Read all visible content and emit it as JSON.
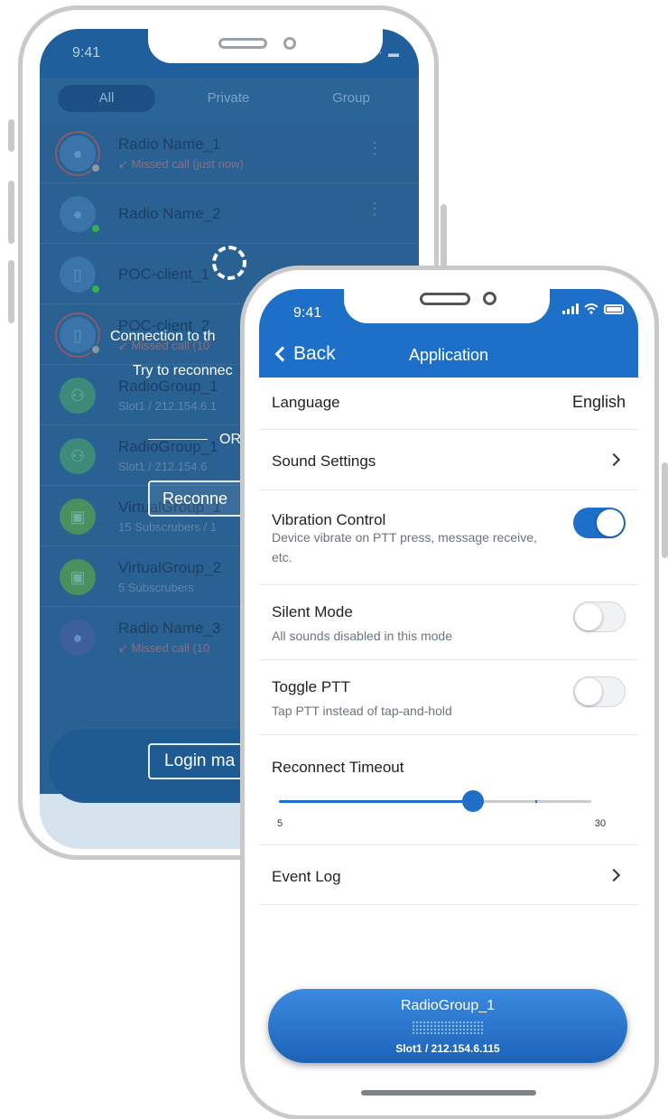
{
  "back_phone": {
    "time": "9:41",
    "tabs": [
      {
        "label": "All",
        "active": true
      },
      {
        "label": "Private",
        "active": false
      },
      {
        "label": "Group",
        "active": false
      }
    ],
    "contacts": [
      {
        "name": "Radio Name_1",
        "sub": "Missed call (just now)",
        "missed": true,
        "status": "grey",
        "icon": "person-icon"
      },
      {
        "name": "Radio Name_2",
        "sub": "",
        "missed": false,
        "status": "green",
        "icon": "person-icon"
      },
      {
        "name": "POC-client_1",
        "sub": "",
        "missed": false,
        "status": "green",
        "icon": "phone-icon"
      },
      {
        "name": "POC-client_2",
        "sub": "Missed call (10",
        "missed": true,
        "status": "grey",
        "icon": "phone-icon"
      },
      {
        "name": "RadioGroup_1",
        "sub": "Slot1 / 212.154.6.1",
        "missed": false,
        "status": "",
        "icon": "group-icon"
      },
      {
        "name": "RadioGroup_1",
        "sub": "Slot1 / 212.154.6",
        "missed": false,
        "status": "",
        "icon": "group-icon"
      },
      {
        "name": "VirtualGroup_1",
        "sub": "15 Subscrubers / 1",
        "missed": false,
        "status": "",
        "icon": "virtual-group-icon"
      },
      {
        "name": "VirtualGroup_2",
        "sub": "5 Subscrubers",
        "missed": false,
        "status": "",
        "icon": "virtual-group-icon"
      },
      {
        "name": "Radio Name_3",
        "sub": "Missed call (10",
        "missed": true,
        "status": "",
        "icon": "person-icon"
      }
    ],
    "overlay": {
      "connection_text": "Connection to th",
      "retry_text": "Try to reconnec",
      "or_text": "OR",
      "reconnect_button": "Reconne",
      "login_button": "Login ma"
    }
  },
  "front_phone": {
    "time": "9:41",
    "back_label": "Back",
    "title": "Application",
    "settings": {
      "language": {
        "label": "Language",
        "value": "English"
      },
      "sound": {
        "label": "Sound Settings"
      },
      "vibration": {
        "label": "Vibration Control",
        "desc": "Device vibrate on PTT press, message receive, etc.",
        "enabled": true
      },
      "silent": {
        "label": "Silent Mode",
        "desc": "All sounds disabled in this mode",
        "enabled": false
      },
      "toggle_ptt": {
        "label": "Toggle PTT",
        "desc": "Tap PTT instead of tap-and-hold",
        "enabled": false
      },
      "reconnect_timeout": {
        "label": "Reconnect Timeout",
        "min": "5",
        "max": "30",
        "value": 0.62
      },
      "event_log": {
        "label": "Event Log"
      }
    },
    "group_bar": {
      "name": "RadioGroup_1",
      "sub": "Slot1 / 212.154.6.115"
    }
  },
  "colors": {
    "accent": "#1e6fc7",
    "back_overlay": "#2a6193",
    "missed": "#8f6d7c",
    "online": "#2fb34a"
  }
}
